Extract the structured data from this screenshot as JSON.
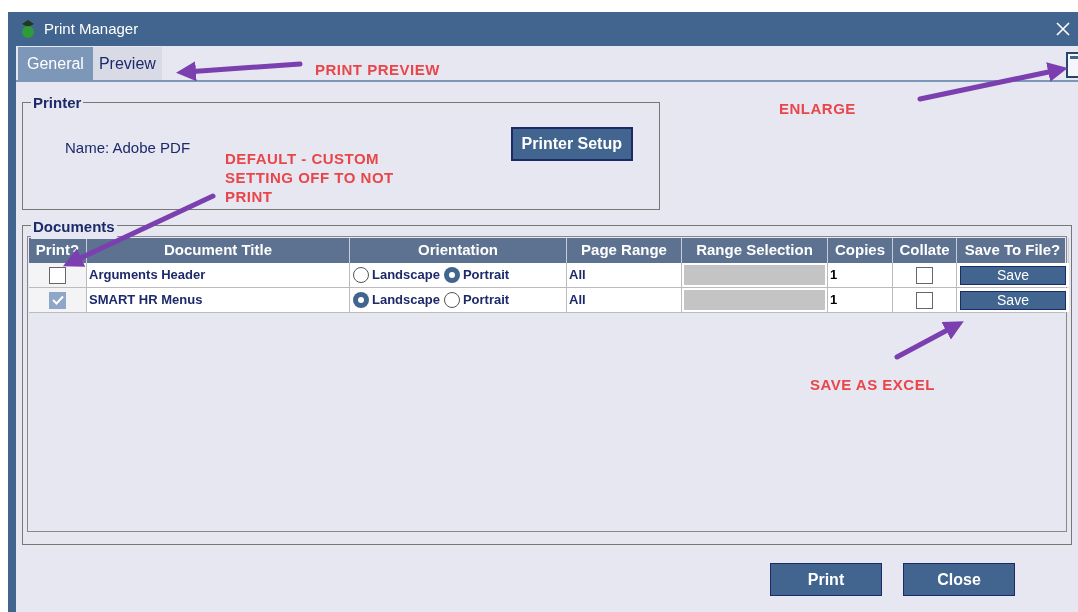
{
  "window": {
    "title": "Print Manager"
  },
  "tabs": [
    {
      "label": "General",
      "selected": true
    },
    {
      "label": "Preview",
      "selected": false
    }
  ],
  "printer": {
    "legend": "Printer",
    "name": "Name: Adobe PDF",
    "setup_button": "Printer Setup"
  },
  "documents": {
    "legend": "Documents",
    "columns": [
      "Print?",
      "Document Title",
      "Orientation",
      "Page Range",
      "Range Selection",
      "Copies",
      "Collate",
      "Save To File?"
    ],
    "rows": [
      {
        "print": false,
        "title": "Arguments Header",
        "orientation": [
          {
            "label": "Landscape",
            "selected": false
          },
          {
            "label": "Portrait",
            "selected": true
          }
        ],
        "page_range": "All",
        "copies": "1",
        "collate": false,
        "save": "Save"
      },
      {
        "print": true,
        "title": "SMART HR Menus",
        "orientation": [
          {
            "label": "Landscape",
            "selected": true
          },
          {
            "label": "Portrait",
            "selected": false
          }
        ],
        "page_range": "All",
        "copies": "1",
        "collate": false,
        "save": "Save"
      }
    ]
  },
  "buttons": [
    "Print",
    "Close"
  ],
  "annotations": [
    {
      "text": "PRINT PREVIEW"
    },
    {
      "text": "ENLARGE"
    },
    {
      "text": "DEFAULT - CUSTOM SETTING OFF TO NOT PRINT"
    },
    {
      "text": "SAVE AS EXCEL"
    }
  ]
}
